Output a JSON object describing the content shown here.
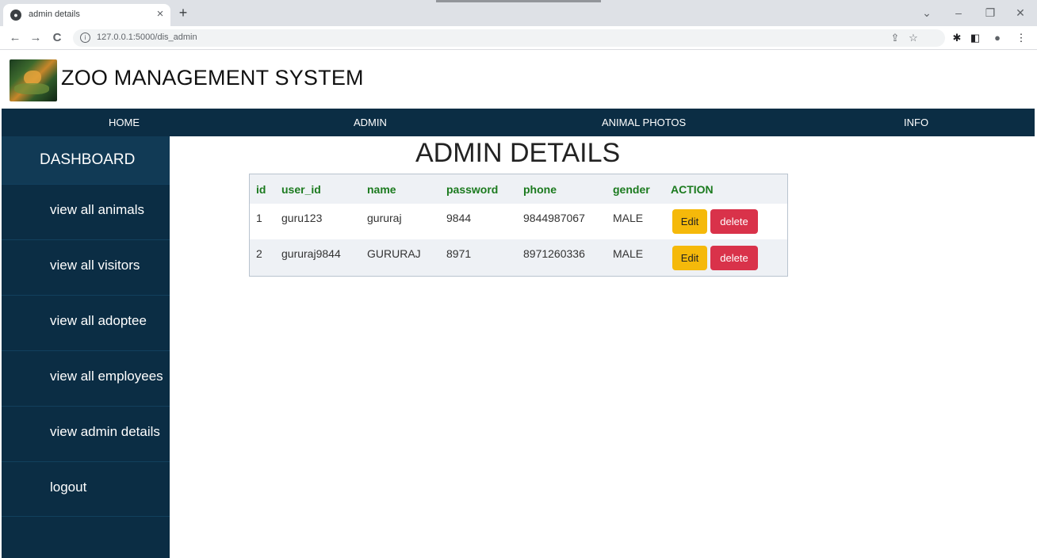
{
  "browser": {
    "tab_title": "admin details",
    "tab_close": "×",
    "new_tab": "+",
    "url": "127.0.0.1:5000/dis_admin",
    "window": {
      "chevron": "⌄",
      "minimize": "–",
      "restore": "❐",
      "close": "✕"
    },
    "nav": {
      "back": "←",
      "forward": "→",
      "reload": "C"
    }
  },
  "header": {
    "title": "ZOO MANAGEMENT SYSTEM"
  },
  "topnav": [
    "HOME",
    "ADMIN",
    "ANIMAL PHOTOS",
    "INFO"
  ],
  "sidebar": {
    "title": "DASHBOARD",
    "items": [
      "view all animals",
      "view all visitors",
      "view all adoptee",
      "view all employees",
      "view admin details",
      "logout"
    ]
  },
  "main": {
    "heading": "ADMIN DETAILS",
    "table": {
      "headers": {
        "id": "id",
        "user_id": "user_id",
        "name": "name",
        "password": "password",
        "phone": "phone",
        "gender": "gender",
        "action": "ACTION"
      },
      "rows": [
        {
          "id": "1",
          "user_id": "guru123",
          "name": "gururaj",
          "password": "9844",
          "phone": "9844987067",
          "gender": "MALE",
          "edit": "Edit",
          "delete": "delete"
        },
        {
          "id": "2",
          "user_id": "gururaj9844",
          "name": "GURURAJ",
          "password": "8971",
          "phone": "8971260336",
          "gender": "MALE",
          "edit": "Edit",
          "delete": "delete"
        }
      ]
    }
  },
  "colors": {
    "nav_bg": "#0b2d44",
    "header_text_green": "#1b7a1e",
    "edit_btn": "#f5b90a",
    "delete_btn": "#d9324a"
  }
}
